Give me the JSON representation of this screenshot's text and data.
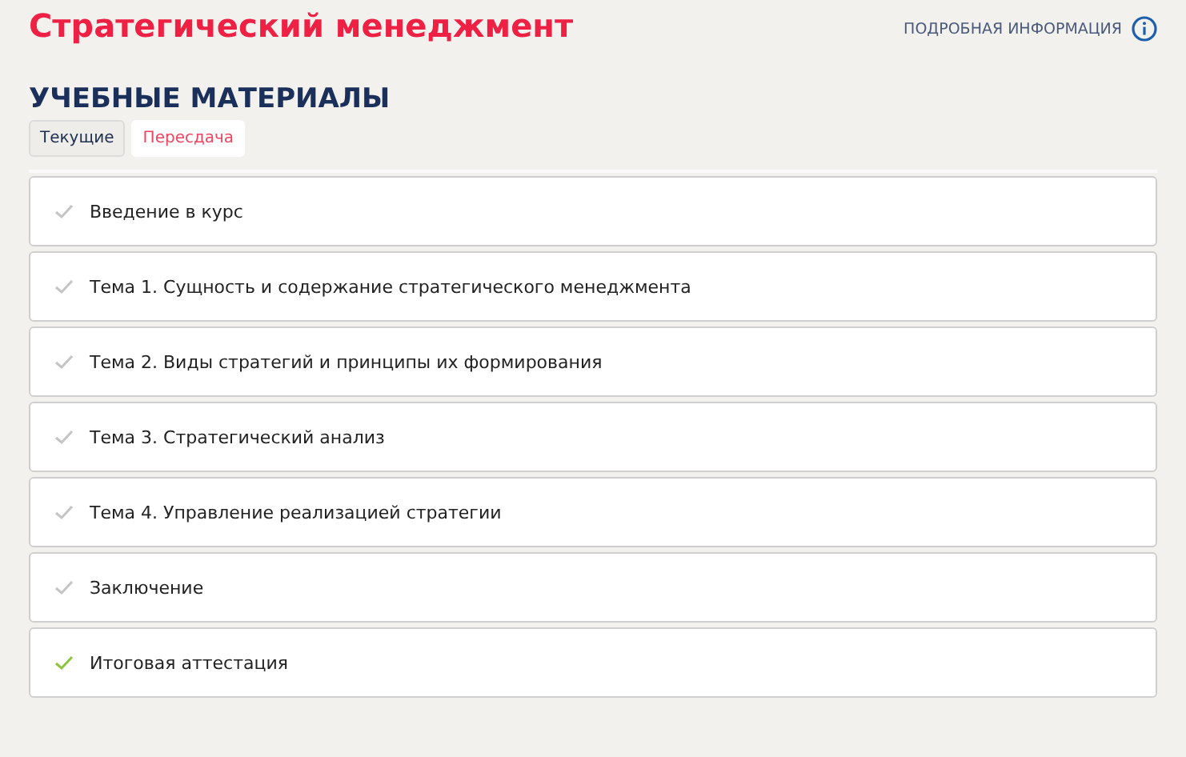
{
  "course_title": "Стратегический менеджмент",
  "info_link": "ПОДРОБНАЯ ИНФОРМАЦИЯ",
  "section_title": "УЧЕБНЫЕ МАТЕРИАЛЫ",
  "tabs": [
    {
      "label": "Текущие",
      "selected": true
    },
    {
      "label": "Пересдача",
      "selected": false
    }
  ],
  "items": [
    {
      "label": "Введение в курс",
      "done": false
    },
    {
      "label": "Тема 1. Сущность и содержание стратегического менеджмента",
      "done": false
    },
    {
      "label": "Тема 2. Виды стратегий и принципы их формирования",
      "done": false
    },
    {
      "label": "Тема 3. Стратегический анализ",
      "done": false
    },
    {
      "label": "Тема 4. Управление реализацией стратегии",
      "done": false
    },
    {
      "label": "Заключение",
      "done": false
    },
    {
      "label": "Итоговая аттестация",
      "done": true
    }
  ]
}
